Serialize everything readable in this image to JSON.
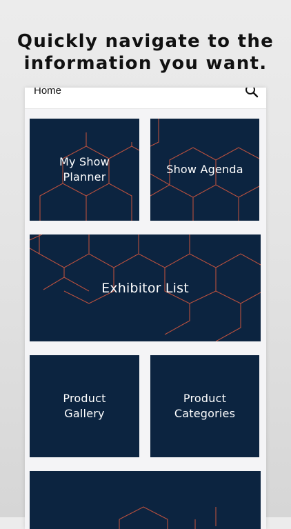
{
  "promo": {
    "headline_line1": "Quickly navigate to the",
    "headline_line2": "information you want."
  },
  "app": {
    "topbar": {
      "title": "Home",
      "search_icon": "search-icon"
    },
    "tiles": [
      {
        "label": "My Show\nPlanner"
      },
      {
        "label": "Show Agenda"
      },
      {
        "label": "Exhibitor List"
      },
      {
        "label": "Product\nGallery"
      },
      {
        "label": "Product\nCategories"
      },
      {
        "label": ""
      }
    ]
  },
  "colors": {
    "tile_background": "#0c2440",
    "pattern_stroke": "#b9503e",
    "page_background": "#e4e4e4",
    "app_background": "#f4f4f6"
  }
}
